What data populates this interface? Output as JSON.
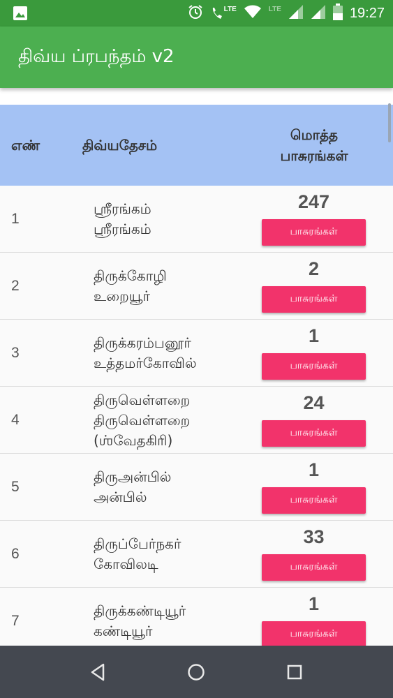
{
  "status_bar": {
    "time": "19:27",
    "lte_1": "LTE",
    "lte_2": "LTE",
    "icons": [
      "image-icon",
      "alarm-icon",
      "wifi-call-icon",
      "wifi-icon",
      "signal-icon",
      "signal-icon",
      "battery-icon"
    ]
  },
  "app_bar": {
    "title": "திவ்ய ப்ரபந்தம் v2"
  },
  "table": {
    "headers": {
      "number": "எண்",
      "temple": "திவ்யதேசம்",
      "total_line1": "மொத்த",
      "total_line2": "பாசுரங்கள்"
    },
    "button_label": "பாசுரங்கள்",
    "rows": [
      {
        "num": "1",
        "line1": "ஸ்ரீரங்கம்",
        "line2": "ஸ்ரீரங்கம்",
        "line3": "",
        "count": "247"
      },
      {
        "num": "2",
        "line1": "திருக்கோழி",
        "line2": "உறையூர்",
        "line3": "",
        "count": "2"
      },
      {
        "num": "3",
        "line1": "திருக்கரம்பனூர்",
        "line2": "உத்தமர்கோவில்",
        "line3": "",
        "count": "1"
      },
      {
        "num": "4",
        "line1": "திருவெள்ளறை",
        "line2": "திருவெள்ளறை",
        "line3": "(ஶ்வேதகிரி)",
        "count": "24"
      },
      {
        "num": "5",
        "line1": "திருஅன்பில்",
        "line2": "அன்பில்",
        "line3": "",
        "count": "1"
      },
      {
        "num": "6",
        "line1": "திருப்பேர்நகர்",
        "line2": "கோவிலடி",
        "line3": "",
        "count": "33"
      },
      {
        "num": "7",
        "line1": "திருக்கண்டியூர்",
        "line2": "கண்டியூர்",
        "line3": "",
        "count": "1"
      }
    ]
  },
  "nav_bar": {
    "icons": [
      "back-icon",
      "home-icon",
      "recents-icon"
    ]
  },
  "colors": {
    "status_bar": "#3a9a3c",
    "app_bar": "#4caf50",
    "header_bg": "#a4c2f4",
    "button": "#f2336b",
    "nav_bar": "#444850"
  }
}
